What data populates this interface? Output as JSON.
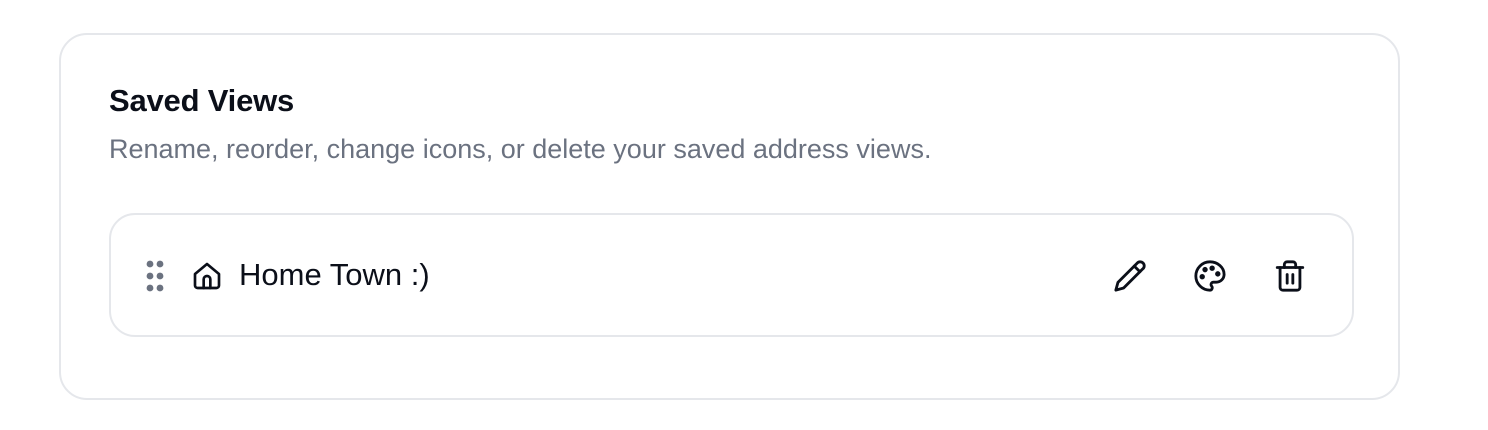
{
  "saved_views": {
    "title": "Saved Views",
    "description": "Rename, reorder, change icons, or delete your saved address views.",
    "items": [
      {
        "name": "Home Town :)",
        "icon": "home-icon",
        "actions": [
          {
            "label": "Rename",
            "icon": "pencil-icon"
          },
          {
            "label": "Change icon",
            "icon": "palette-icon"
          },
          {
            "label": "Delete",
            "icon": "trash-icon"
          }
        ]
      }
    ]
  },
  "colors": {
    "text_primary": "#0b0f19",
    "text_muted": "#6b7280",
    "border": "#e5e7eb",
    "handle": "#6b7280"
  }
}
